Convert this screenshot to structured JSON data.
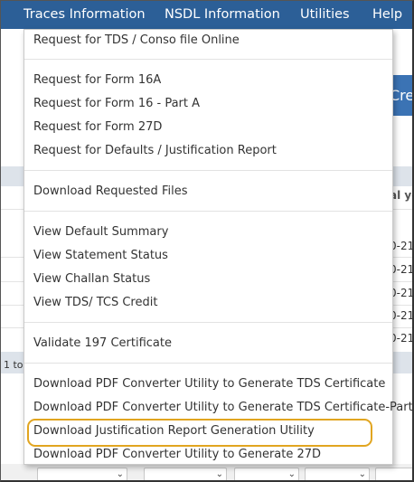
{
  "menubar": {
    "items": [
      {
        "label": "Traces Information"
      },
      {
        "label": "NSDL Information"
      },
      {
        "label": "Utilities"
      },
      {
        "label": "Help"
      }
    ]
  },
  "background": {
    "button_label": "Cre",
    "column_header": "al ye",
    "row_values": [
      "0-21",
      "0-21",
      "0-21",
      "0-21",
      "0-21"
    ],
    "pagination_text": "1 to"
  },
  "dropdown": {
    "items": [
      {
        "label": "Request for TDS / Conso file Online"
      },
      {
        "label": "Request for Form 16A"
      },
      {
        "label": "Request for Form 16 - Part A"
      },
      {
        "label": "Request for Form 27D"
      },
      {
        "label": "Request for Defaults / Justification Report"
      },
      {
        "label": "Download Requested Files"
      },
      {
        "label": "View Default Summary"
      },
      {
        "label": "View Statement Status"
      },
      {
        "label": "View Challan Status"
      },
      {
        "label": "View TDS/ TCS Credit"
      },
      {
        "label": "Validate 197 Certificate"
      },
      {
        "label": "Download PDF Converter Utility to Generate TDS Certificate"
      },
      {
        "label": "Download PDF Converter Utility to Generate TDS Certificate-PartB"
      },
      {
        "label": "Download Justification Report Generation Utility"
      },
      {
        "label": "Download PDF Converter Utility to Generate 27D"
      }
    ],
    "highlighted_item": "Download Justification Report Generation Utility",
    "highlight_color": "#e1a520"
  },
  "colors": {
    "menubar_bg": "#2c5f97",
    "accent_button": "#3b73b4"
  }
}
